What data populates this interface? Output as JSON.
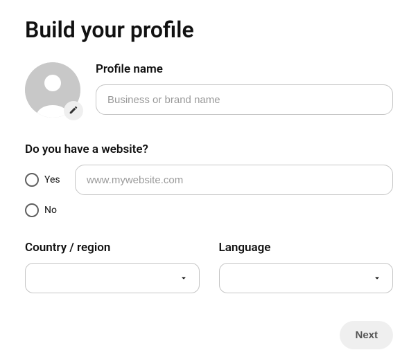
{
  "title": "Build your profile",
  "profile": {
    "name_label": "Profile name",
    "name_placeholder": "Business or brand name",
    "name_value": ""
  },
  "website": {
    "question": "Do you have a website?",
    "yes_label": "Yes",
    "no_label": "No",
    "url_placeholder": "www.mywebsite.com",
    "url_value": ""
  },
  "country": {
    "label": "Country / region",
    "value": ""
  },
  "language": {
    "label": "Language",
    "value": ""
  },
  "next_button": "Next"
}
